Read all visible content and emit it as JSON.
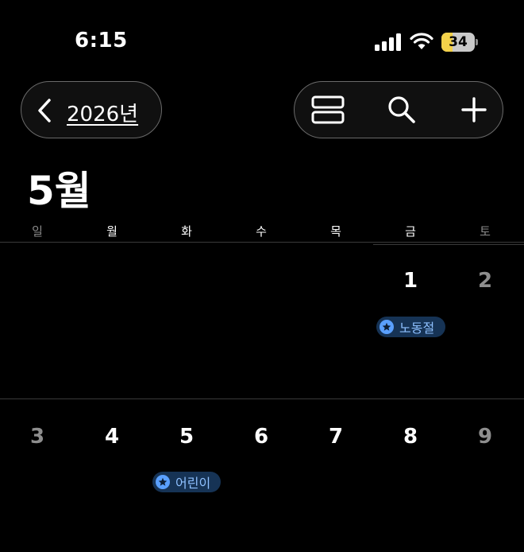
{
  "status_bar": {
    "time": "6:15",
    "battery_level": "34",
    "battery_color": "#f4d24a"
  },
  "nav": {
    "back_label": "2026년",
    "icons": [
      "back-chevron-icon",
      "list-view-icon",
      "search-icon",
      "add-icon"
    ]
  },
  "month_title": "5월",
  "weekdays": [
    "일",
    "월",
    "화",
    "수",
    "목",
    "금",
    "토"
  ],
  "weeks": [
    {
      "days": [
        "",
        "",
        "",
        "",
        "",
        "1",
        "2"
      ]
    },
    {
      "days": [
        "3",
        "4",
        "5",
        "6",
        "7",
        "8",
        "9"
      ]
    }
  ],
  "events": [
    {
      "day": "1",
      "label": "노동절",
      "icon": "star-icon",
      "color": "#5aa0ff"
    },
    {
      "day": "5",
      "label": "어린이",
      "icon": "star-icon",
      "color": "#5aa0ff"
    }
  ]
}
